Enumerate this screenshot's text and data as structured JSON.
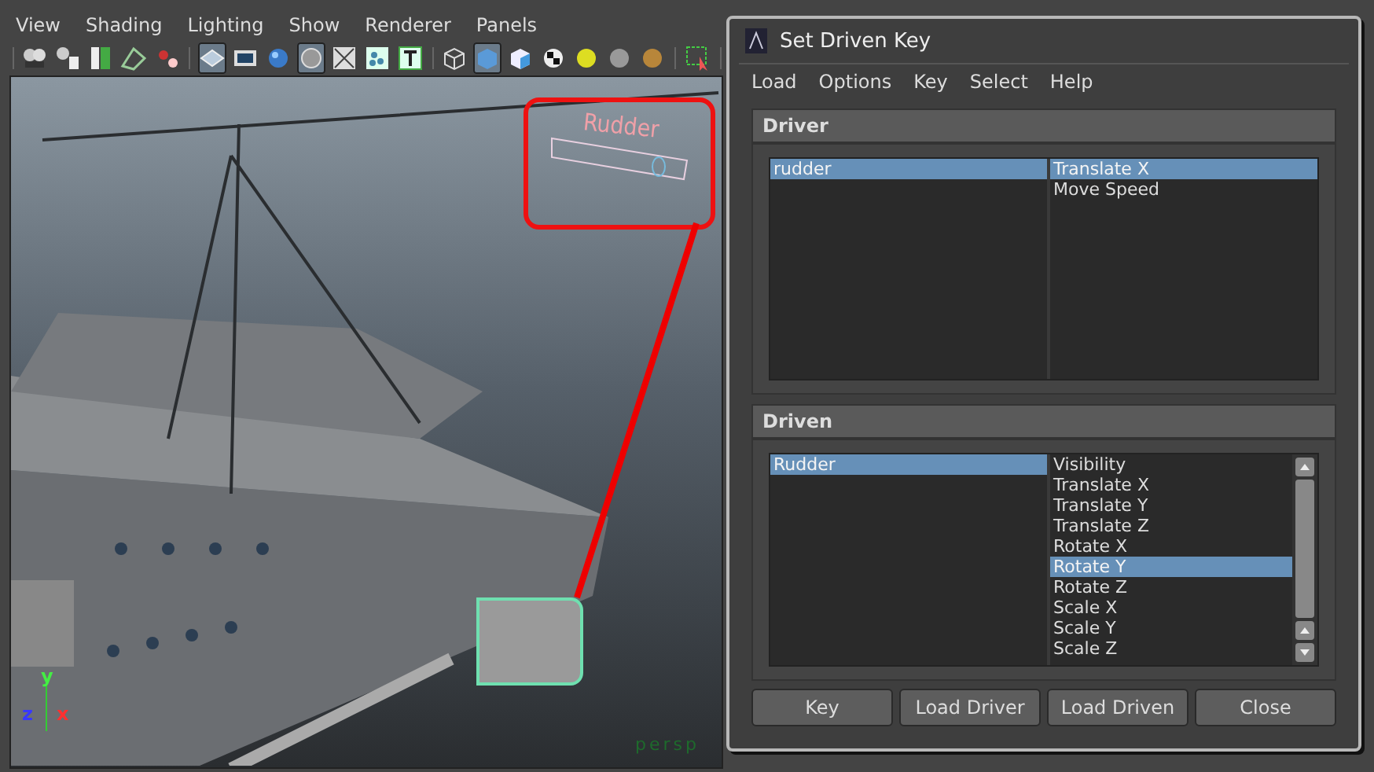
{
  "viewport": {
    "menu": [
      "View",
      "Shading",
      "Lighting",
      "Show",
      "Renderer",
      "Panels"
    ],
    "toolbar": [
      [
        {
          "pressed": false
        },
        {
          "pressed": false
        },
        {
          "pressed": false
        },
        {
          "pressed": false
        },
        {
          "pressed": false
        }
      ],
      [
        {
          "pressed": true
        },
        {
          "pressed": false
        },
        {
          "pressed": false
        },
        {
          "pressed": true
        },
        {
          "pressed": false
        },
        {
          "pressed": false
        },
        {
          "pressed": false
        }
      ],
      [
        {
          "pressed": false
        },
        {
          "pressed": true
        },
        {
          "pressed": false
        },
        {
          "pressed": false
        },
        {
          "pressed": false
        },
        {
          "pressed": false
        },
        {
          "pressed": false
        }
      ],
      [
        {
          "pressed": false
        }
      ]
    ],
    "control_label": "Rudder",
    "axes": [
      "y",
      "z",
      "x"
    ],
    "camera_label": "persp"
  },
  "dialog": {
    "title": "Set Driven Key",
    "menu": [
      "Load",
      "Options",
      "Key",
      "Select",
      "Help"
    ],
    "driver": {
      "header": "Driver",
      "objects": [
        {
          "label": "rudder",
          "selected": true
        }
      ],
      "attributes": [
        {
          "label": "Translate X",
          "selected": true
        },
        {
          "label": "Move Speed",
          "selected": false
        }
      ]
    },
    "driven": {
      "header": "Driven",
      "objects": [
        {
          "label": "Rudder",
          "selected": true
        }
      ],
      "attributes": [
        {
          "label": "Visibility",
          "selected": false
        },
        {
          "label": "Translate X",
          "selected": false
        },
        {
          "label": "Translate Y",
          "selected": false
        },
        {
          "label": "Translate Z",
          "selected": false
        },
        {
          "label": "Rotate X",
          "selected": false
        },
        {
          "label": "Rotate Y",
          "selected": true
        },
        {
          "label": "Rotate Z",
          "selected": false
        },
        {
          "label": "Scale X",
          "selected": false
        },
        {
          "label": "Scale Y",
          "selected": false
        },
        {
          "label": "Scale Z",
          "selected": false
        }
      ]
    },
    "buttons": [
      "Key",
      "Load Driver",
      "Load Driven",
      "Close"
    ]
  }
}
